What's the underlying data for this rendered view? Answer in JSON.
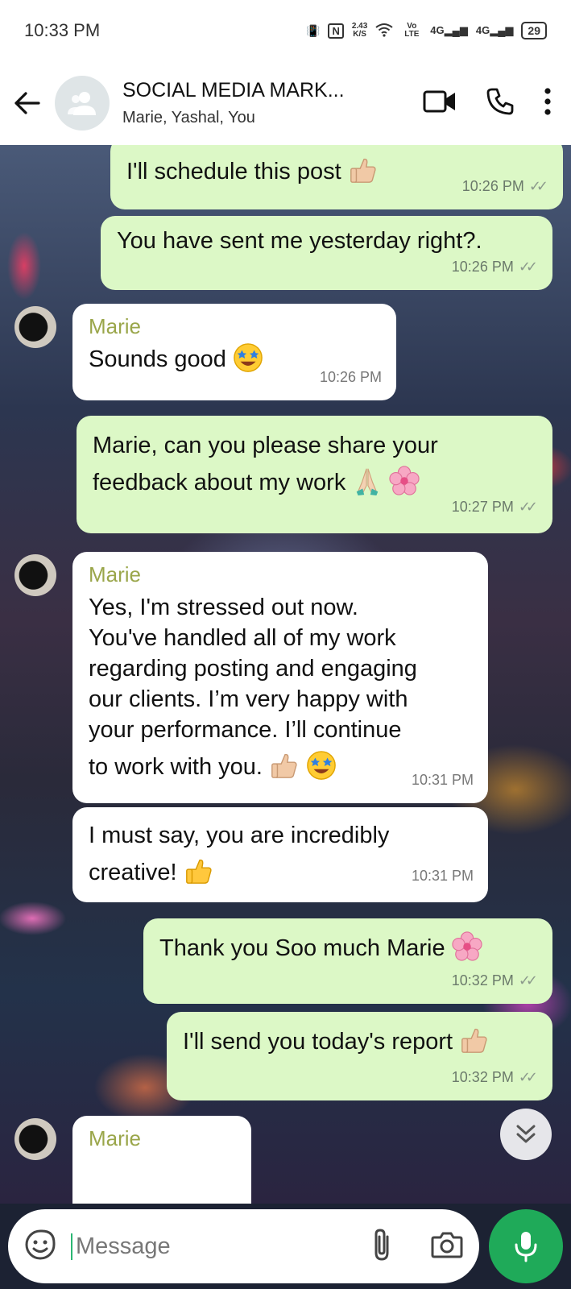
{
  "status_bar": {
    "time": "10:33 PM",
    "speed_value": "2.43",
    "speed_unit": "K/S",
    "network_label": "Vo LTE",
    "signal_1": "4G",
    "signal_2": "4G",
    "battery": "29"
  },
  "header": {
    "title": "SOCIAL MEDIA MARK...",
    "members": "Marie, Yashal, You"
  },
  "messages": {
    "m1": {
      "text": "I'll schedule this post",
      "time": "10:26 PM"
    },
    "m2": {
      "text": "You have sent me yesterday right?.",
      "time": "10:26 PM"
    },
    "m3": {
      "sender": "Marie",
      "text": "Sounds good",
      "time": "10:26 PM"
    },
    "m4": {
      "line1": "Marie, can you please share your",
      "line2": "feedback about my work",
      "time": "10:27 PM"
    },
    "m5": {
      "sender": "Marie",
      "line1": "Yes, I'm stressed out now.",
      "line2": "You've handled all of my work",
      "line3": "regarding posting and engaging",
      "line4": "our clients. I’m very happy with",
      "line5": "your performance. I’ll continue",
      "line6": "to work with you.",
      "time": "10:31 PM"
    },
    "m6": {
      "line1": "I must say, you are incredibly",
      "line2": "creative!",
      "time": "10:31 PM"
    },
    "m7": {
      "text": "Thank you Soo much Marie",
      "time": "10:32 PM"
    },
    "m8": {
      "text": "I'll send you today's report",
      "time": "10:32 PM"
    },
    "m9": {
      "sender": "Marie"
    }
  },
  "input": {
    "placeholder": "Message"
  },
  "colors": {
    "outgoing_bubble": "#dcf8c6",
    "incoming_bubble": "#ffffff",
    "sender_name": "#9aa64a",
    "mic_button": "#1faa59"
  }
}
